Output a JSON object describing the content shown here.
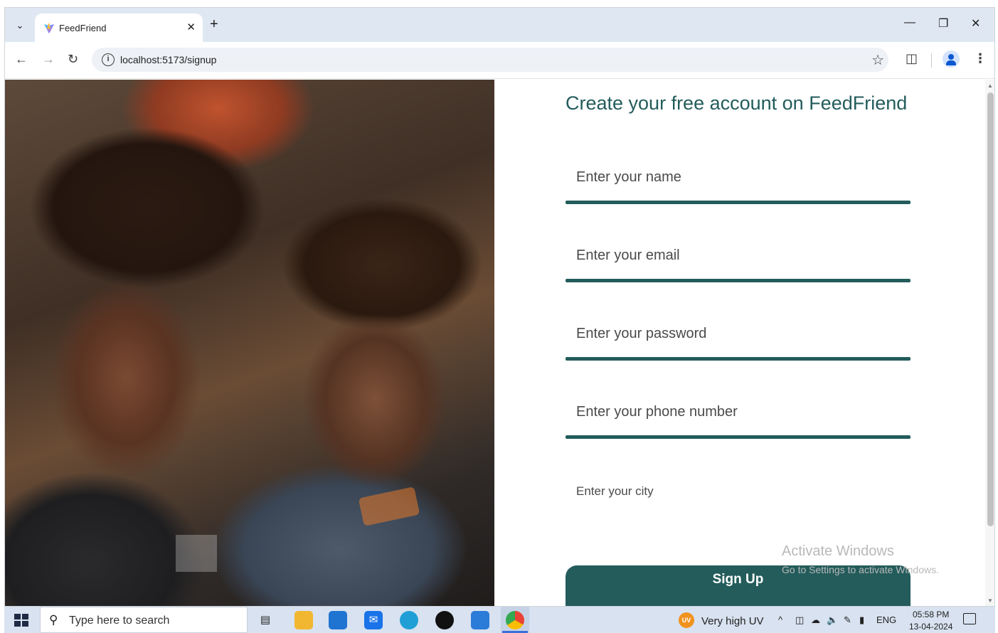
{
  "browser": {
    "tab": {
      "title": "FeedFriend"
    },
    "url": "localhost:5173/signup"
  },
  "page": {
    "heading": "Create your free account on FeedFriend",
    "fields": [
      {
        "placeholder": "Enter your name"
      },
      {
        "placeholder": "Enter your email"
      },
      {
        "placeholder": "Enter your password"
      },
      {
        "placeholder": "Enter your phone number"
      },
      {
        "placeholder": "Enter your city"
      }
    ],
    "submit_label": "Sign Up",
    "accent_color": "#235c5b"
  },
  "watermark": {
    "line1": "Activate Windows",
    "line2": "Go to Settings to activate Windows."
  },
  "taskbar": {
    "search_placeholder": "Type here to search",
    "weather_badge": "UV",
    "weather_text": "Very high UV",
    "language": "ENG",
    "time": "05:58 PM",
    "date": "13-04-2024"
  }
}
